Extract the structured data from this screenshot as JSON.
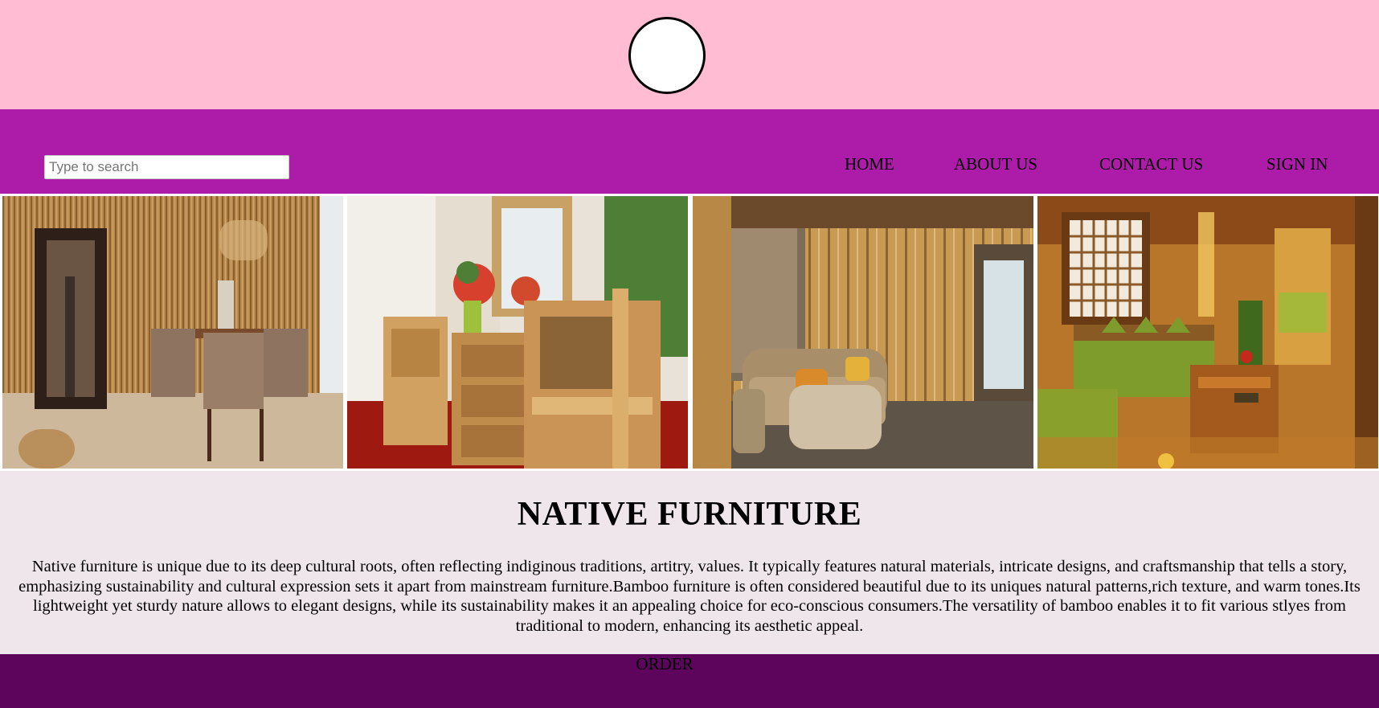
{
  "header": {
    "logo_icon": "circle-logo-icon"
  },
  "nav": {
    "search_placeholder": "Type to search",
    "links": [
      "HOME",
      "ABOUT US",
      "CONTACT US",
      "SIGN IN"
    ]
  },
  "gallery": {
    "images": [
      "bamboo-dining-room",
      "bamboo-chairs-dresser",
      "wicker-living-room",
      "bamboo-bedroom-interior"
    ]
  },
  "main": {
    "title": "NATIVE FURNITURE",
    "description": "Native furniture is unique due to its deep cultural roots, often reflecting indiginous traditions, artitry, values. It typically features natural materials, intricate designs, and craftsmanship that tells a story, emphasizing sustainability and cultural expression sets it apart from mainstream furniture.Bamboo furniture is often considered beautiful due to its uniques natural patterns,rich texture, and warm tones.Its lightweight yet sturdy nature allows to elegant designs, while its sustainability makes it an appealing choice for eco-conscious consumers.The versatility of bamboo enables it to fit various stlyes from traditional to modern, enhancing its aesthetic appeal."
  },
  "footer": {
    "order_label": "ORDER"
  },
  "colors": {
    "topbar": "#ffbcd2",
    "navbar": "#ad1ca8",
    "content": "#efe6ec",
    "footer": "#5d045d"
  }
}
